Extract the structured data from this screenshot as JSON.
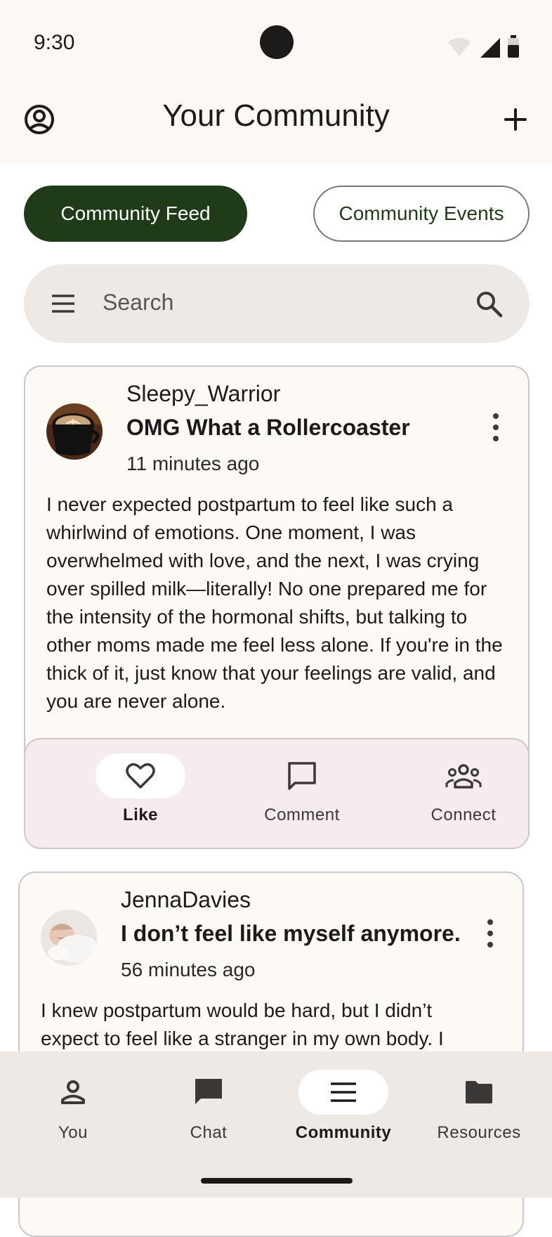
{
  "status_bar": {
    "time": "9:30"
  },
  "app_bar": {
    "title": "Your Community"
  },
  "tabs": [
    {
      "label": "Community Feed",
      "selected": true
    },
    {
      "label": "Community Events",
      "selected": false
    }
  ],
  "search": {
    "placeholder": "Search"
  },
  "posts": [
    {
      "username": "Sleepy_Warrior",
      "title": "OMG What a Rollercoaster",
      "time": "11 minutes ago",
      "body": "I never expected postpartum to feel like such a whirlwind of emotions. One moment, I was overwhelmed with love, and the next, I was crying over spilled milk—literally! No one prepared me for the intensity of the hormonal shifts, but talking to other moms made me feel less alone. If you're in the thick of it, just know that your feelings are valid, and you are never alone.",
      "actions": [
        {
          "label": "Like",
          "icon": "heart-icon",
          "active": true
        },
        {
          "label": "Comment",
          "icon": "comment-icon",
          "active": false
        },
        {
          "label": "Connect",
          "icon": "group-icon",
          "active": false
        }
      ]
    },
    {
      "username": "JennaDavies",
      "title": "I don’t feel like myself anymore.",
      "time": "56 minutes ago",
      "body": "I knew postpartum would be hard, but I didn’t expect to feel like a stranger in my own body. I"
    }
  ],
  "bottom_nav": [
    {
      "label": "You",
      "icon": "person-icon",
      "active": false
    },
    {
      "label": "Chat",
      "icon": "chat-icon",
      "active": false
    },
    {
      "label": "Community",
      "icon": "menu-icon",
      "active": true
    },
    {
      "label": "Resources",
      "icon": "folder-icon",
      "active": false
    }
  ],
  "colors": {
    "primary": "#1f3b17",
    "surface": "#fdf8f3",
    "action_bar": "#f6eced"
  }
}
